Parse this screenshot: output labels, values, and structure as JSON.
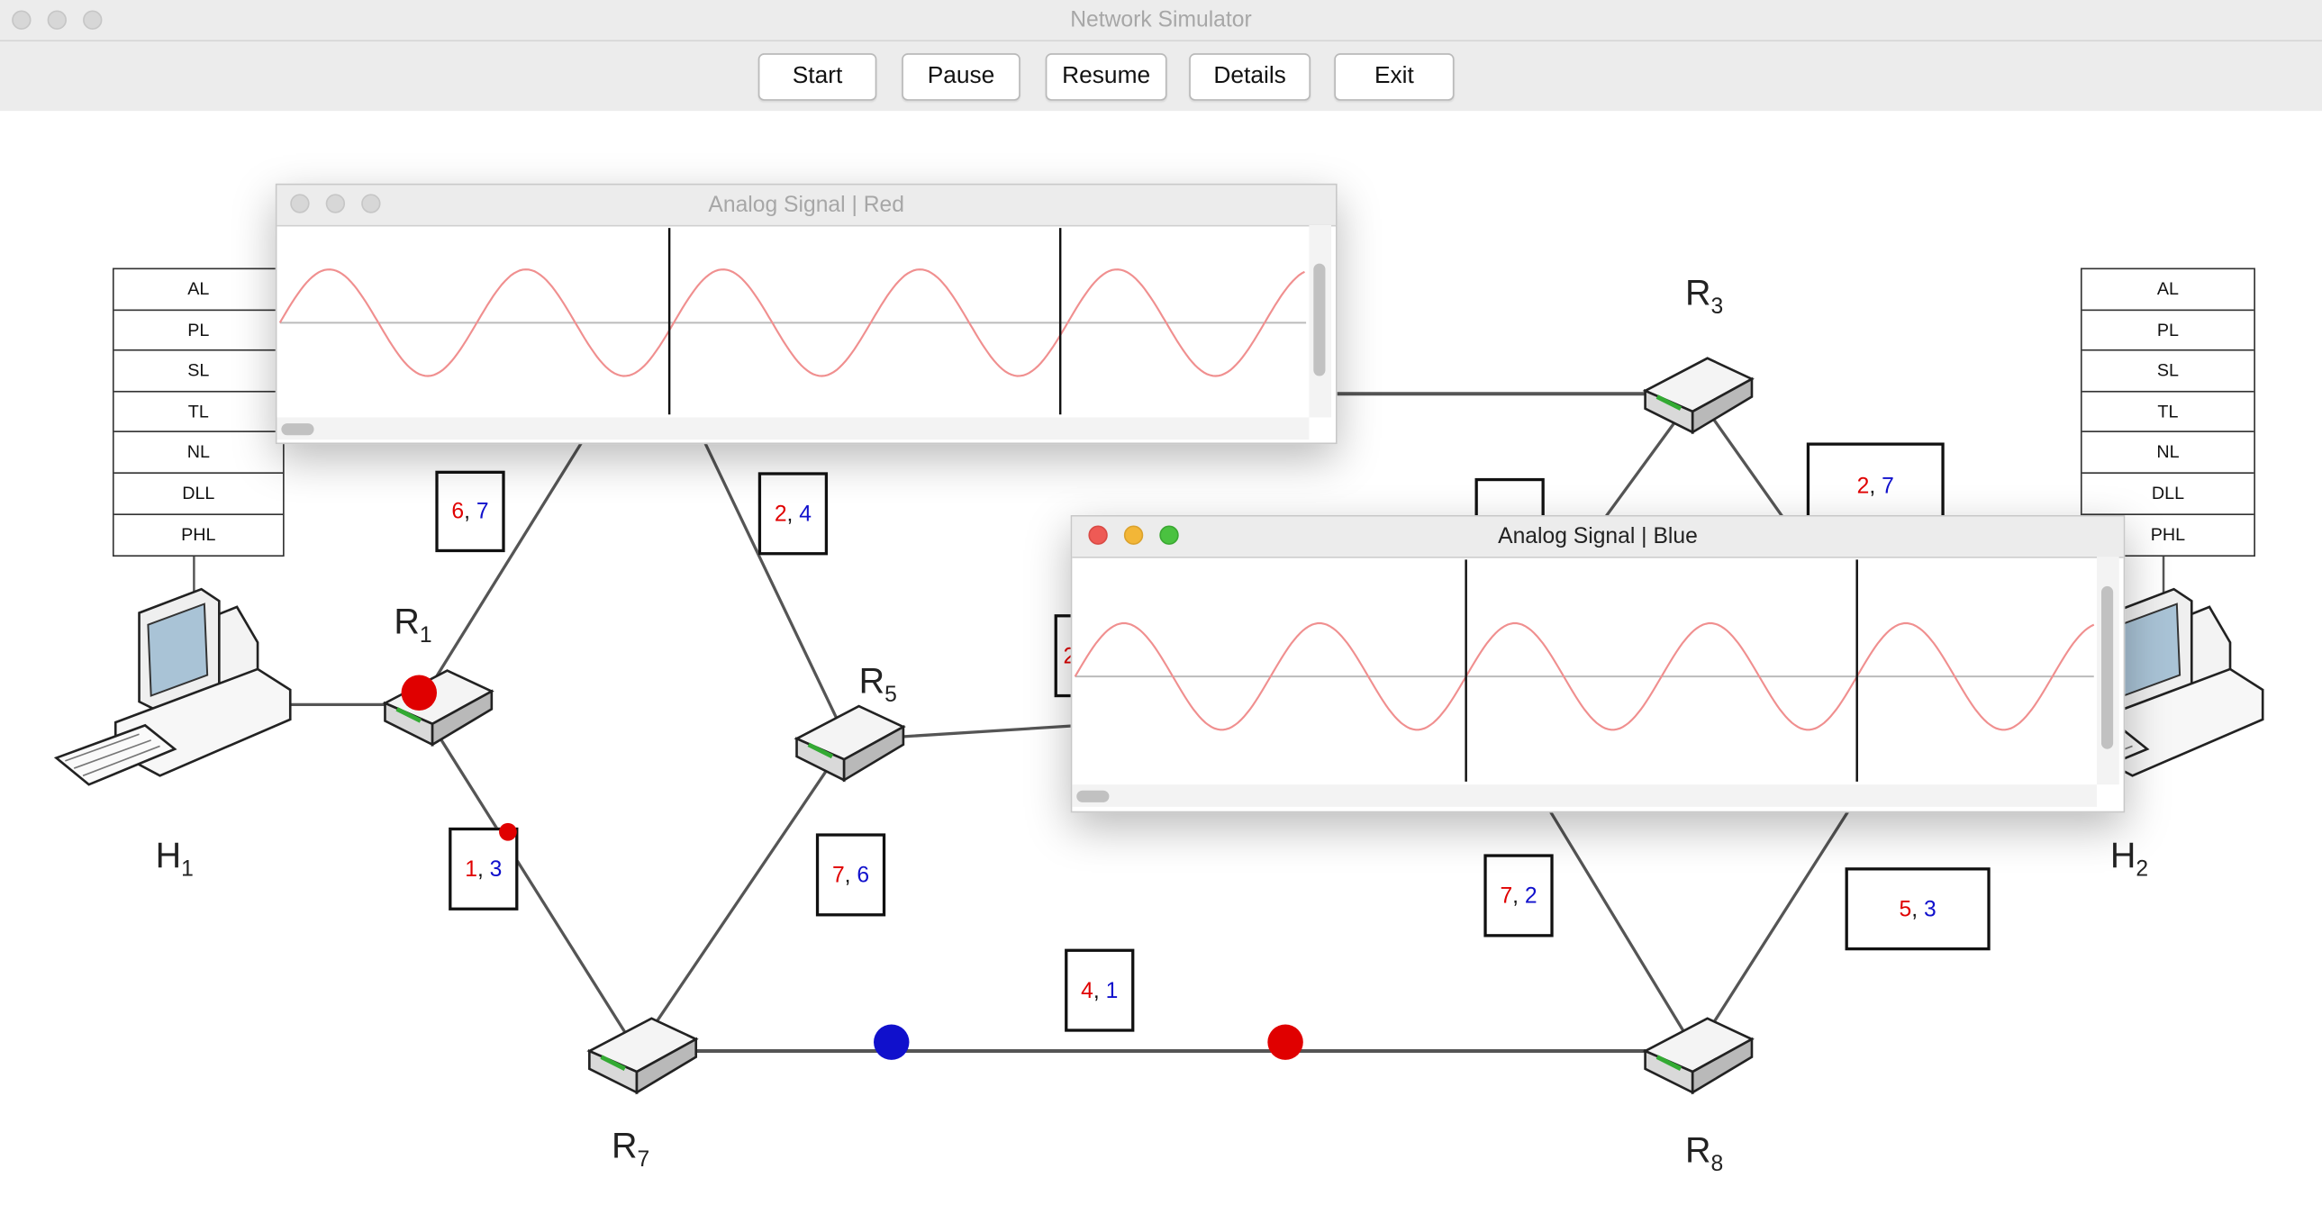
{
  "window": {
    "title": "Network Simulator"
  },
  "toolbar": {
    "start": "Start",
    "pause": "Pause",
    "resume": "Resume",
    "details": "Details",
    "exit": "Exit"
  },
  "hosts": [
    {
      "name": "H",
      "sub": "1"
    },
    {
      "name": "H",
      "sub": "2"
    }
  ],
  "routers": {
    "r1": {
      "name": "R",
      "sub": "1"
    },
    "r3": {
      "name": "R",
      "sub": "3"
    },
    "r5": {
      "name": "R",
      "sub": "5"
    },
    "r7": {
      "name": "R",
      "sub": "7"
    },
    "r8": {
      "name": "R",
      "sub": "8"
    }
  },
  "layers": [
    "AL",
    "PL",
    "SL",
    "TL",
    "NL",
    "DLL",
    "PHL"
  ],
  "packets": {
    "p1": {
      "red": "6",
      "sep": ",",
      "blue": "7"
    },
    "p2": {
      "red": "2",
      "sep": ",",
      "blue": "4"
    },
    "p3": {
      "red": "1",
      "sep": ",",
      "blue": "3"
    },
    "p4": {
      "red": "7",
      "sep": ",",
      "blue": "6"
    },
    "p5": {
      "red": "4",
      "sep": ",",
      "blue": "1"
    },
    "p6": {
      "red": "2",
      "sep": ",",
      "blue": "7"
    },
    "p7": {
      "red": "7",
      "sep": ",",
      "blue": "2"
    },
    "p8": {
      "red": "5",
      "sep": ",",
      "blue": "3"
    },
    "p9": {
      "red": "2",
      "sep": "",
      "blue": ""
    }
  },
  "signal_windows": {
    "red": {
      "title": "Analog Signal | Red"
    },
    "blue": {
      "title": "Analog Signal | Blue"
    }
  },
  "colors": {
    "red_signal": "#e00000",
    "blue_signal": "#1010cc",
    "wave": "#f08f8f",
    "chrome": "#ececec"
  }
}
